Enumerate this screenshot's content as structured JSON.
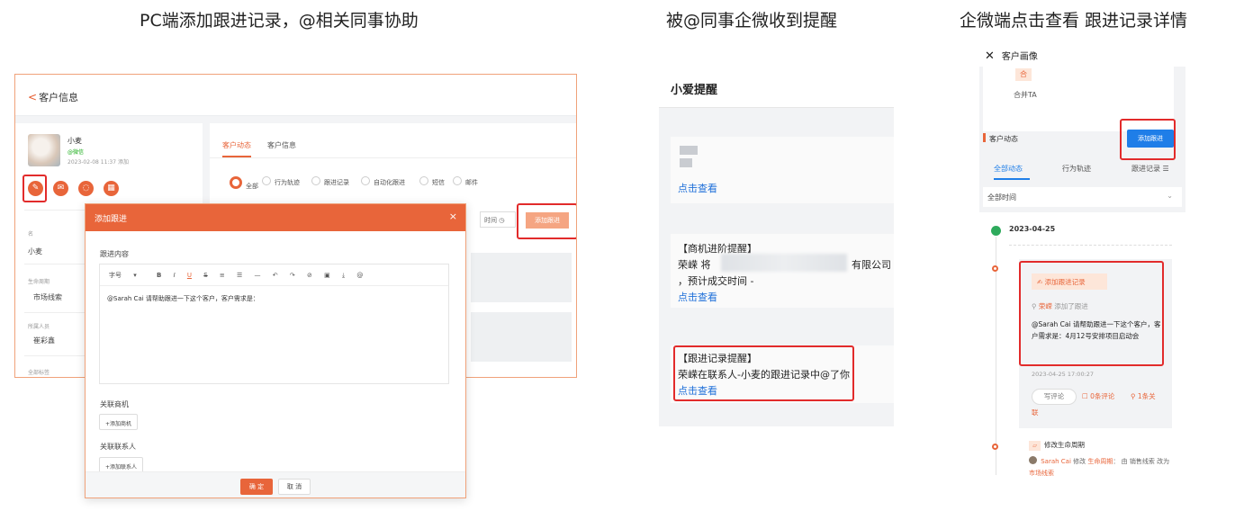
{
  "captions": {
    "pc": "PC端添加跟进记录，@相关同事协助",
    "wecom": "被@同事企微收到提醒",
    "mobile": "企微端点击查看 跟进记录详情"
  },
  "pc": {
    "back_label": "客户信息",
    "customer": {
      "name": "小麦",
      "source": "@微信",
      "added": "2023-02-08 11:37 添加"
    },
    "action_icons": [
      "edit-icon",
      "mail-icon",
      "chat-icon",
      "calendar-icon"
    ],
    "fields": [
      {
        "label": "名",
        "value": "小麦"
      },
      {
        "label": "生命周期",
        "value": "市场线索"
      },
      {
        "label": "所属人员",
        "value": "崔彩鑫"
      },
      {
        "label": "全部标签",
        "value": ""
      }
    ],
    "tabs": [
      "客户动态",
      "客户信息"
    ],
    "filters": [
      "全部",
      "行为轨迹",
      "跟进记录",
      "自动化跟进",
      "短信",
      "邮件"
    ],
    "time_filter": "时间",
    "add_followup_label": "添加跟进",
    "dialog": {
      "title": "添加跟进",
      "content_label": "跟进内容",
      "toolbar": [
        "字号",
        "B",
        "I",
        "U",
        "S",
        "≡",
        "☰",
        "—",
        "↶",
        "↷",
        "⊘",
        "▣",
        "⤓",
        "@"
      ],
      "content": "@Sarah Cai 请帮助跟进一下这个客户，客户需求是：",
      "opp_label": "关联商机",
      "opp_btn": "+添加商机",
      "contact_label": "关联联系人",
      "contact_btn": "+添加联系人",
      "ok": "确 定",
      "cancel": "取 消"
    }
  },
  "wecom": {
    "title": "小爱提醒",
    "link": "点击查看",
    "opp_title": "【商机进阶提醒】",
    "opp_text_1": "荣嵘 将",
    "opp_text_1b": "有限公司",
    "opp_text_2": "，预计成交时间 -",
    "fu_title": "【跟进记录提醒】",
    "fu_text": "荣嵘在联系人-小麦的跟进记录中@了你"
  },
  "mobile": {
    "header": "客户画像",
    "merge_icon": "合",
    "merge_label": "合并TA",
    "section": "客户动态",
    "add_btn": "添加跟进",
    "tabs": [
      "全部动态",
      "行为轨迹",
      "跟进记录 ☰"
    ],
    "time_filter": "全部时间",
    "date": "2023-04-25",
    "feed_tag": "添加跟进记录",
    "author": "荣嵘",
    "action": "添加了跟进",
    "body": "@Sarah Cai 请帮助跟进一下这个客户，客户需求是：4月12号安排项目启动会",
    "timestamp": "2023-04-25 17:00:27",
    "comment_btn": "写评论",
    "comment_count": "0条评论",
    "related": "1条关",
    "related_2": "联",
    "lifecycle_tag": "修改生命周期",
    "log_user": "Sarah Cai",
    "log_mid": "修改",
    "log_field": "生命周期",
    "log_from": "由 销售线索",
    "log_to_pre": "改为",
    "log_to": "市场线索"
  },
  "colors": {
    "accent": "#e8653a",
    "highlight": "#e22b2b",
    "wecom_link": "#1e6fd9",
    "mobile_blue": "#1f7ee8"
  }
}
